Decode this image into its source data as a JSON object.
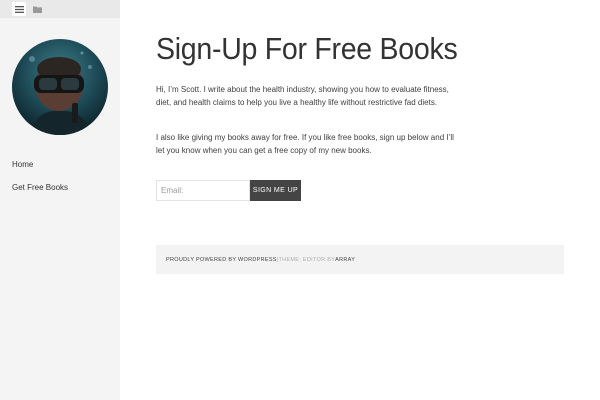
{
  "toolbar": {
    "menu_icon": "menu-icon",
    "folder_icon": "folder-icon"
  },
  "sidebar": {
    "avatar": "avatar-snorkel-photo",
    "nav": [
      {
        "label": "Home"
      },
      {
        "label": "Get Free Books"
      }
    ]
  },
  "main": {
    "title": "Sign-Up For Free Books",
    "para1": "Hi, I’m Scott. I write about the health industry, showing you how to evaluate fitness, diet, and health claims to help you live a healthy life without restrictive fad diets.",
    "para2": "I also like giving my books away for free. If you like free books, sign up below and I’ll let you know when you can get a free copy of my new books.",
    "form": {
      "email_placeholder": "Email:",
      "button_label": "SIGN ME UP"
    }
  },
  "footer": {
    "powered": "PROUDLY POWERED BY WORDPRESS",
    "separator": "|",
    "theme": " THEME: EDITOR BY ",
    "author": "ARRAY"
  },
  "colors": {
    "sidebar_bg": "#f4f4f4",
    "toolbar_bg": "#e9e9e9",
    "button_bg": "#444444",
    "footer_bg": "#f3f3f3"
  }
}
